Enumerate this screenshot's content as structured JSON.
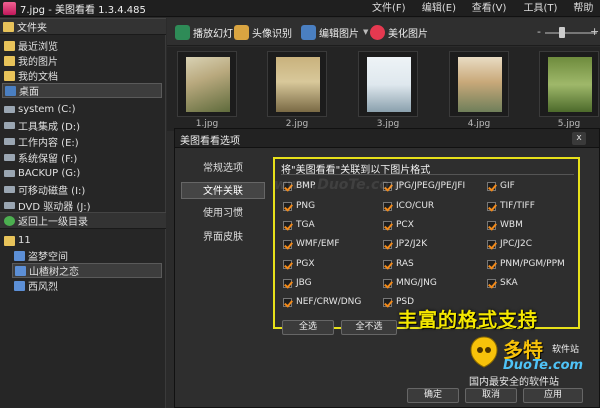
{
  "window": {
    "title": "7.jpg - 美图看看 1.3.4.485",
    "menu": [
      "文件(F)",
      "编辑(E)",
      "查看(V)",
      "工具(T)",
      "帮助(H)"
    ]
  },
  "sidebar": {
    "folder_header": "文件夹",
    "top_items": [
      "最近浏览",
      "我的图片",
      "我的文档",
      "桌面"
    ],
    "drives": [
      "system (C:)",
      "工具集成 (D:)",
      "工作内容 (E:)",
      "系统保留 (F:)",
      "BACKUP (G:)",
      "可移动磁盘 (I:)",
      "DVD 驱动器 (J:)"
    ],
    "back_label": "返回上一级目录",
    "tree": [
      "11",
      "盗梦空间",
      "山楂树之恋",
      "西风烈"
    ]
  },
  "toolbar": {
    "slideshow": "播放幻灯",
    "face_detect": "头像识别",
    "edit_image": "编辑图片",
    "beautify": "美化图片"
  },
  "thumbnails": [
    "1.jpg",
    "2.jpg",
    "3.jpg",
    "4.jpg",
    "5.jpg"
  ],
  "dialog": {
    "title": "美图看看选项",
    "close": "x",
    "nav": [
      "常规选项",
      "文件关联",
      "使用习惯",
      "界面皮肤"
    ],
    "panel_title": "将\"美图看看\"关联到以下图片格式",
    "formats": [
      "BMP",
      "JPG/JPEG/JPE/JFI",
      "GIF",
      "PNG",
      "ICO/CUR",
      "TIF/TIFF",
      "TGA",
      "PCX",
      "WBM",
      "WMF/EMF",
      "JP2/J2K",
      "JPC/J2C",
      "PGX",
      "RAS",
      "PNM/PGM/PPM",
      "JBG",
      "MNG/JNG",
      "SKA",
      "NEF/CRW/DNG",
      "PSD"
    ],
    "select_all": "全选",
    "select_none": "全不选",
    "ok": "确定",
    "cancel": "取消",
    "apply": "应用"
  },
  "promo_text": "丰富的格式支持",
  "watermark": {
    "top_url": "www.DuoTe.com",
    "logo_name": "多特",
    "logo_sub": "软件站",
    "logo_url": "DuoTe.com",
    "slogan": "国内最安全的软件站"
  },
  "colors": {
    "highlight_border": "#e8e11a",
    "checkmark": "#f28a1a",
    "promo": "#f5e800"
  }
}
